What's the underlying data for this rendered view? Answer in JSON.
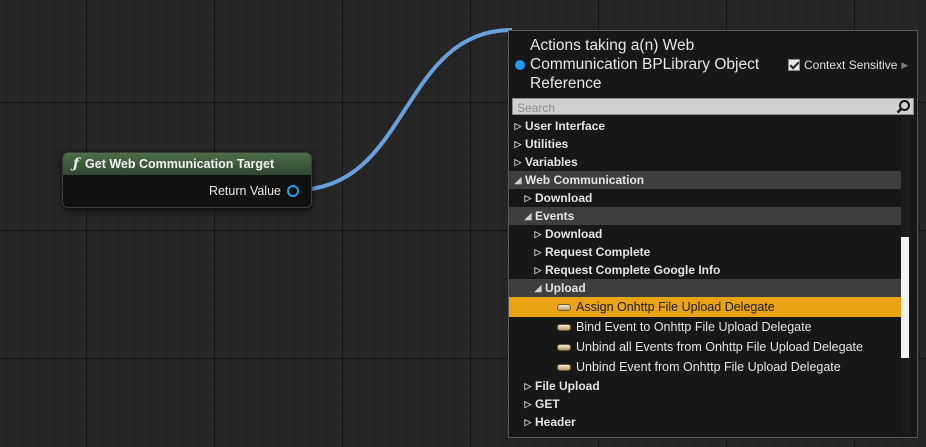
{
  "node": {
    "icon": "function-icon",
    "title": "Get Web Communication Target",
    "pin_label": "Return Value",
    "header_color": "#4b6e48",
    "pin_color": "#1e9cf0"
  },
  "menu": {
    "title": "Actions taking a(n) Web Communication BPLibrary Object Reference",
    "context_sensitive_label": "Context Sensitive",
    "context_sensitive_checked": true,
    "search_placeholder": "Search",
    "selection_color": "#e8a413",
    "items": [
      {
        "label": "User Interface",
        "expanded": false
      },
      {
        "label": "Utilities",
        "expanded": false
      },
      {
        "label": "Variables",
        "expanded": false
      },
      {
        "label": "Web Communication",
        "expanded": true
      },
      {
        "label": "Download",
        "expanded": false
      },
      {
        "label": "Events",
        "expanded": true
      },
      {
        "label": "Download",
        "expanded": false
      },
      {
        "label": "Request Complete",
        "expanded": false
      },
      {
        "label": "Request Complete Google Info",
        "expanded": false
      },
      {
        "label": "Upload",
        "expanded": true
      },
      {
        "label": "Assign Onhttp File Upload Delegate",
        "selected": true
      },
      {
        "label": "Bind Event to Onhttp File Upload Delegate"
      },
      {
        "label": "Unbind all Events from Onhttp File Upload Delegate"
      },
      {
        "label": "Unbind Event from Onhttp File Upload Delegate"
      },
      {
        "label": "File Upload",
        "expanded": false
      },
      {
        "label": "GET",
        "expanded": false
      },
      {
        "label": "Header",
        "expanded": false
      }
    ]
  }
}
